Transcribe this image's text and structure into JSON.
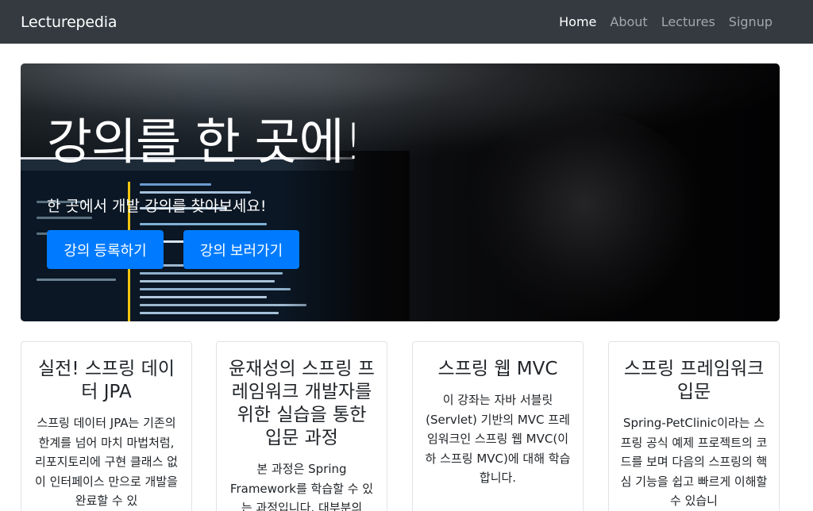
{
  "navbar": {
    "brand": "Lecturepedia",
    "links": [
      {
        "label": "Home",
        "active": true
      },
      {
        "label": "About",
        "active": false
      },
      {
        "label": "Lectures",
        "active": false
      },
      {
        "label": "Signup",
        "active": false
      }
    ]
  },
  "hero": {
    "title": "강의를 한 곳에!",
    "subtitle": "한 곳에서 개발 강의를 찾아보세요!",
    "register_button": "강의 등록하기",
    "browse_button": "강의 보러가기"
  },
  "cards": [
    {
      "title": "실전! 스프링 데이터 JPA",
      "text": "스프링 데이터 JPA는 기존의 한계를 넘어 마치 마법처럼, 리포지토리에 구현 클래스 없이 인터페이스 만으로 개발을 완료할 수 있"
    },
    {
      "title": "윤재성의 스프링 프레임워크 개발자를 위한 실습을 통한 입문 과정",
      "text": "본 과정은 Spring Framework를 학습할 수 있는 과정입니다. 대부분의"
    },
    {
      "title": "스프링 웹 MVC",
      "text": "이 강좌는 자바 서블릿(Servlet) 기반의 MVC 프레임워크인 스프링 웹 MVC(이하 스프링 MVC)에 대해 학습합니다."
    },
    {
      "title": "스프링 프레임워크 입문",
      "text": "Spring-PetClinic이라는 스프링 공식 예제 프로젝트의 코드를 보며 다음의 스프링의 핵심 기능을 쉽고 빠르게 이해할 수 있습니"
    }
  ],
  "colors": {
    "navbar_bg": "#343a40",
    "primary": "#007bff"
  }
}
